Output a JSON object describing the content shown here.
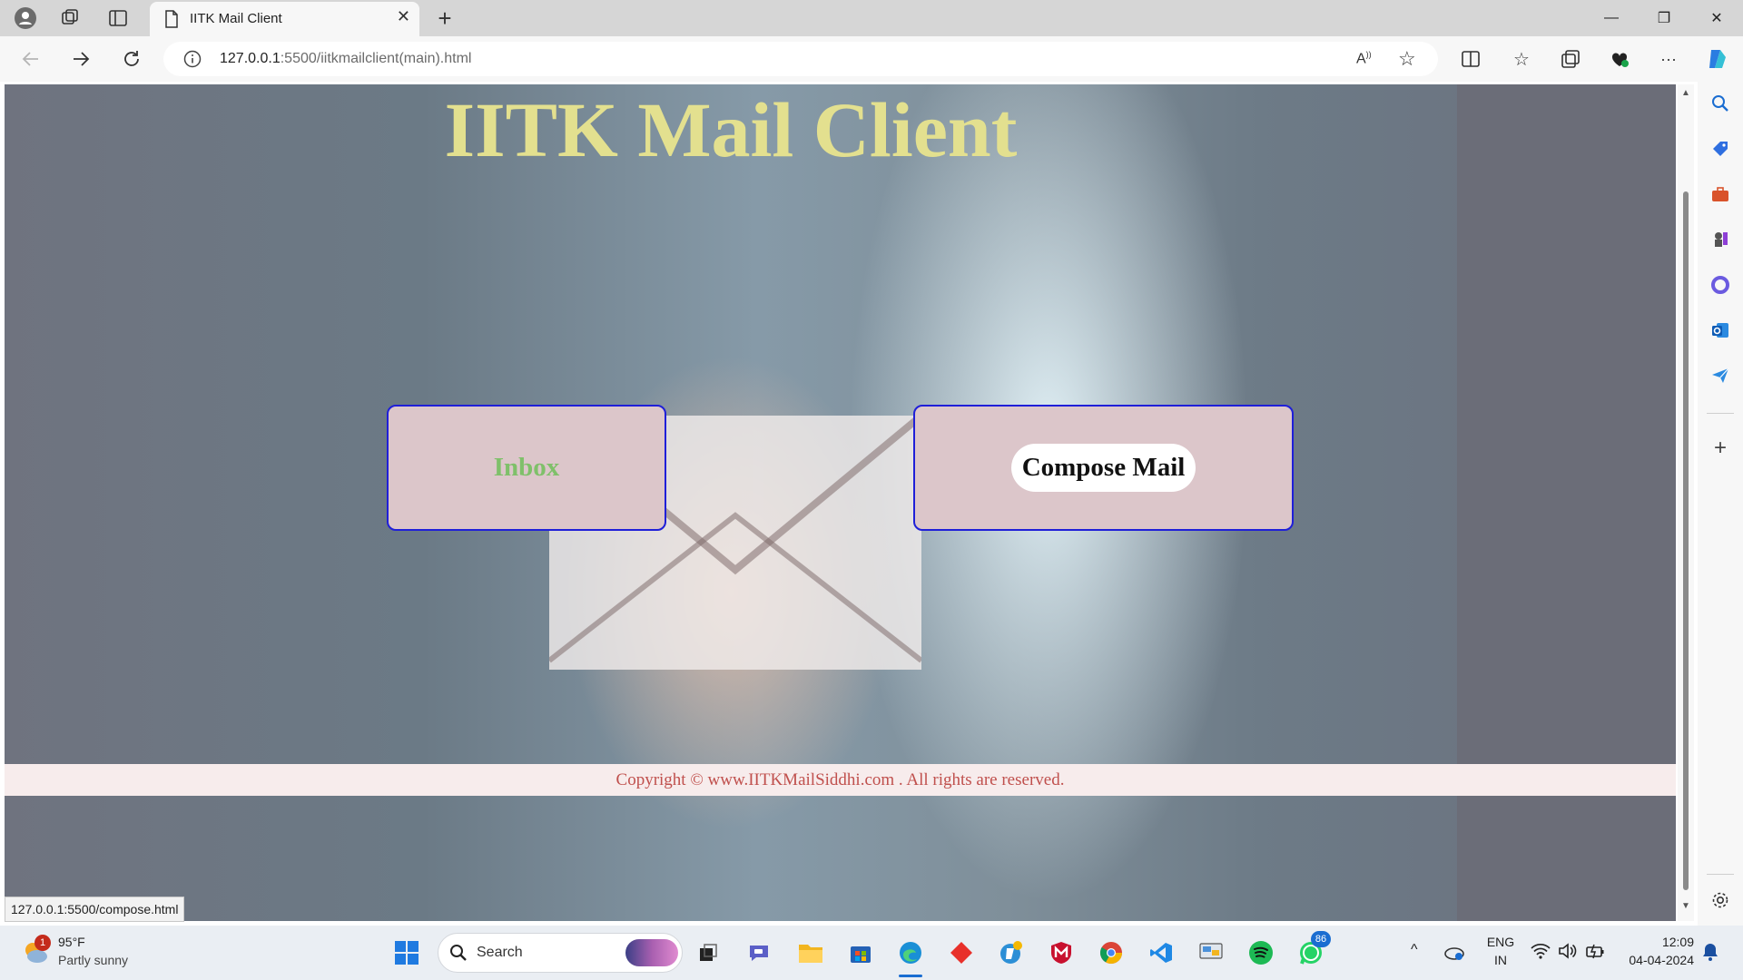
{
  "browser": {
    "tab": {
      "title": "IITK Mail Client",
      "close_glyph": "✕"
    },
    "new_tab_glyph": "+",
    "window_controls": {
      "minimize": "—",
      "restore": "❐",
      "close": "✕"
    },
    "url": {
      "host": "127.0.0.1",
      "path": ":5500/iitkmailclient(main).html"
    },
    "status_tip": "127.0.0.1:5500/compose.html"
  },
  "page": {
    "title": "IITK Mail Client",
    "inbox_label": "Inbox",
    "compose_label": "Compose Mail",
    "footer": "Copyright © www.IITKMailSiddhi.com . All rights are reserved."
  },
  "taskbar": {
    "weather": {
      "temp": "95°F",
      "condition": "Partly sunny",
      "badge": "1"
    },
    "search_label": "Search",
    "whatsapp_badge": "86",
    "language": {
      "lang": "ENG",
      "region": "IN"
    },
    "clock": {
      "time": "12:09",
      "date": "04-04-2024"
    }
  },
  "colors": {
    "title": "#e3e08f",
    "panel_bg": "#dcc6ca",
    "panel_border": "#1f1fd8",
    "inbox_text": "#7fc06a",
    "footer_text": "#c0504d"
  }
}
